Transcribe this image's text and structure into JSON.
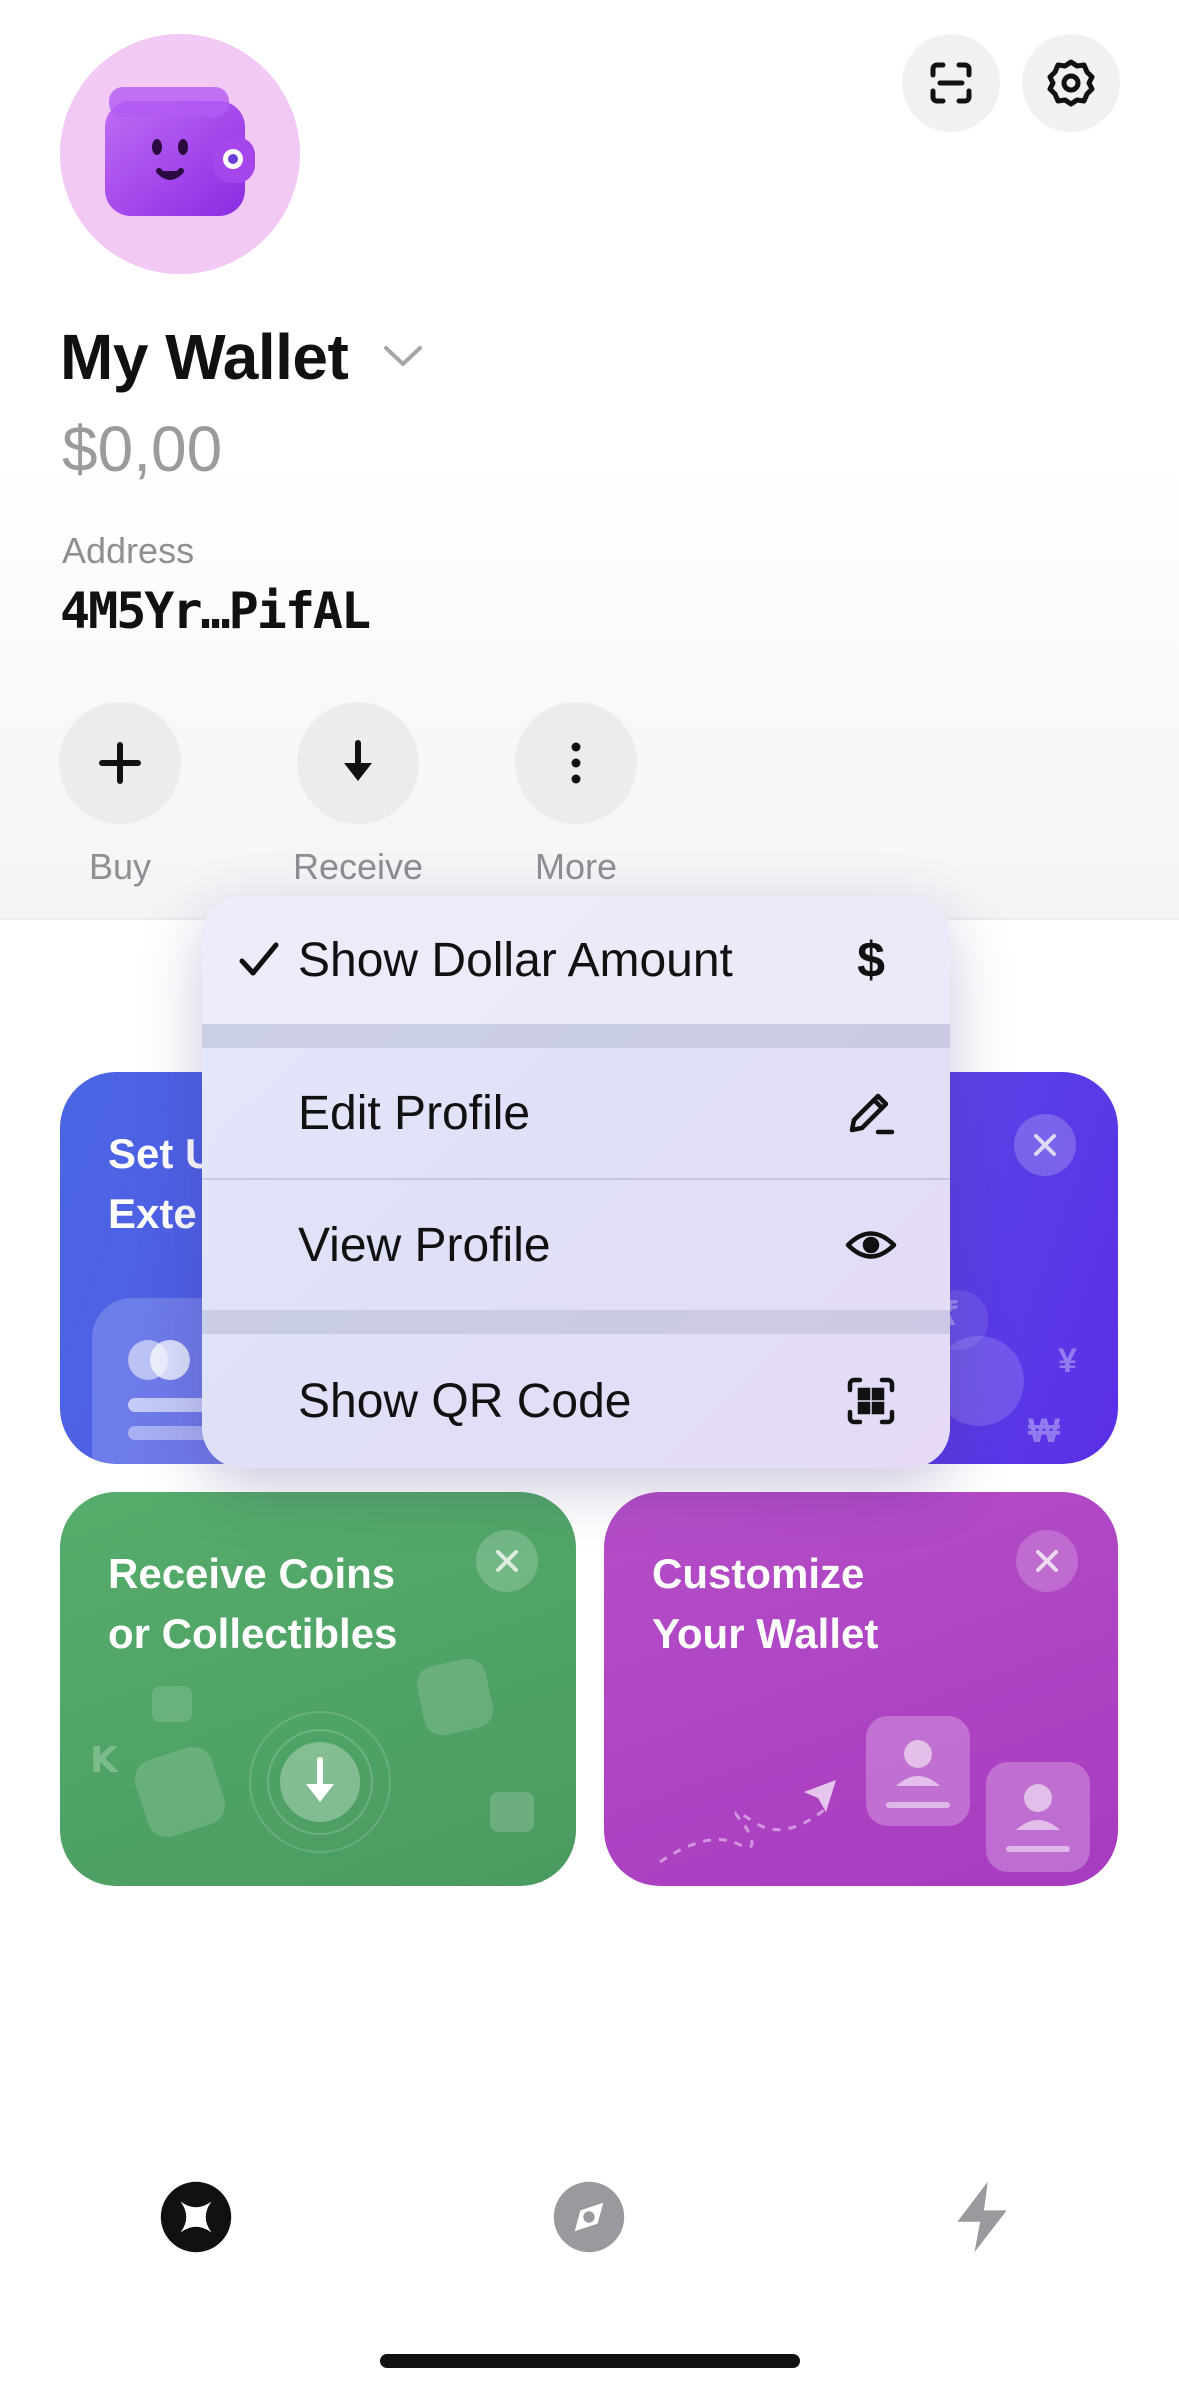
{
  "header": {
    "scan_icon": "scan-icon",
    "settings_icon": "gear-icon"
  },
  "wallet": {
    "name": "My Wallet",
    "balance": "$0,00",
    "address_label": "Address",
    "address_value": "4M5Yr…PifAL"
  },
  "actions": [
    {
      "label": "Buy",
      "icon": "plus-icon"
    },
    {
      "label": "Receive",
      "icon": "arrow-down-icon"
    },
    {
      "label": "More",
      "icon": "more-vertical-icon"
    }
  ],
  "menu": {
    "items": [
      {
        "label": "Show Dollar Amount",
        "checked": true,
        "icon": "dollar-icon"
      },
      {
        "label": "Edit Profile",
        "checked": false,
        "icon": "pencil-icon"
      },
      {
        "label": "View Profile",
        "checked": false,
        "icon": "eye-icon"
      },
      {
        "label": "Show QR Code",
        "checked": false,
        "icon": "qr-icon"
      }
    ],
    "dollar_glyph": "$"
  },
  "cards": [
    {
      "title_line1": "Set U",
      "title_line2": "Exte",
      "color": "#4f60e6"
    },
    {
      "title_line1": "Receive Coins",
      "title_line2": "or Collectibles",
      "color": "#4c9e62"
    },
    {
      "title_line1": "Customize",
      "title_line2": "Your Wallet",
      "color": "#b347c2"
    }
  ],
  "card_currency_symbols": [
    "₹",
    "¥",
    "₩"
  ],
  "tabbar": {
    "items": [
      {
        "icon": "home-icon",
        "active": true
      },
      {
        "icon": "explore-icon",
        "active": false
      },
      {
        "icon": "activity-icon",
        "active": false
      }
    ]
  },
  "colors": {
    "avatar_bg": "#f2c8f4",
    "wallet_purple": "#9a3ce8",
    "muted": "#8e8e93"
  }
}
